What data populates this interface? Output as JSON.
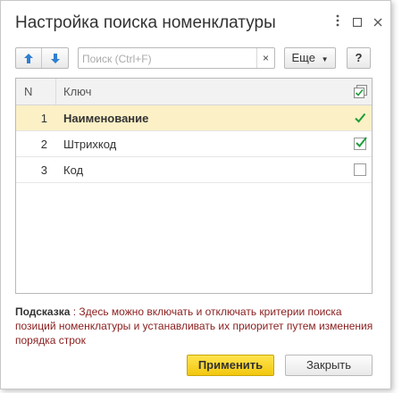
{
  "window": {
    "title": "Настройка поиска номенклатуры",
    "menu_icon": "kebab-icon",
    "maximize_icon": "maximize-icon",
    "close_icon": "close-icon"
  },
  "toolbar": {
    "move_up_icon": "arrow-up-icon",
    "move_down_icon": "arrow-down-icon",
    "search_placeholder": "Поиск (Ctrl+F)",
    "search_value": "",
    "clear_label": "×",
    "more_label": "Еще",
    "help_label": "?"
  },
  "grid": {
    "headers": {
      "n": "N",
      "key": "Ключ",
      "check_icon": "check-all-icon"
    },
    "rows": [
      {
        "n": "1",
        "key": "Наименование",
        "checked": true,
        "selected": true
      },
      {
        "n": "2",
        "key": "Штрихкод",
        "checked": true,
        "selected": false
      },
      {
        "n": "3",
        "key": "Код",
        "checked": false,
        "selected": false
      }
    ]
  },
  "hint": {
    "label": "Подсказка",
    "text": " : Здесь можно включать и отключать критерии поиска позиций номенклатуры и устанавливать их приоритет путем изменения порядка строк"
  },
  "buttons": {
    "apply": "Применить",
    "close": "Закрыть"
  },
  "colors": {
    "accent_yellow": "#f2c70f",
    "selected_row": "#fbf0c6",
    "check_green": "#1f9c3a",
    "arrow_blue": "#2f7fd0",
    "hint_text": "#8a1d1d"
  }
}
